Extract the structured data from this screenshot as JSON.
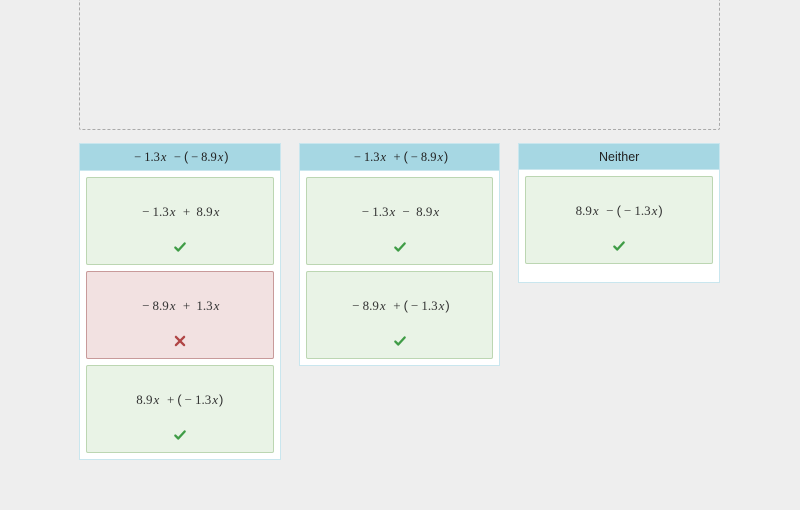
{
  "columns": [
    {
      "header_html": "<span class='mop'>−</span><span class='mnum'>1.3</span><span class='mi'>x</span> <span class='mop'>−</span>(<span class='mop'>−</span><span class='mnum'>8.9</span><span class='mi'>x</span>)",
      "cards": [
        {
          "expr_html": "<span class='mop'>−</span><span class='mnum'>1.3</span><span class='mi'>x</span><span class='mop'> + </span><span class='mnum'>8.9</span><span class='mi'>x</span>",
          "status": "correct"
        },
        {
          "expr_html": "<span class='mop'>−</span><span class='mnum'>8.9</span><span class='mi'>x</span><span class='mop'> + </span><span class='mnum'>1.3</span><span class='mi'>x</span>",
          "status": "incorrect"
        },
        {
          "expr_html": "<span class='mnum'>8.9</span><span class='mi'>x</span> <span class='mop'>+</span>(<span class='mop'>−</span><span class='mnum'>1.3</span><span class='mi'>x</span>)",
          "status": "correct"
        }
      ]
    },
    {
      "header_html": "<span class='mop'>−</span><span class='mnum'>1.3</span><span class='mi'>x</span> <span class='mop'>+</span>(<span class='mop'>−</span><span class='mnum'>8.9</span><span class='mi'>x</span>)",
      "cards": [
        {
          "expr_html": "<span class='mop'>−</span><span class='mnum'>1.3</span><span class='mi'>x</span><span class='mop'> − </span><span class='mnum'>8.9</span><span class='mi'>x</span>",
          "status": "correct"
        },
        {
          "expr_html": "<span class='mop'>−</span><span class='mnum'>8.9</span><span class='mi'>x</span> <span class='mop'>+</span>(<span class='mop'>−</span><span class='mnum'>1.3</span><span class='mi'>x</span>)",
          "status": "correct"
        }
      ]
    },
    {
      "header_html": "Neither",
      "cards": [
        {
          "expr_html": "<span class='mnum'>8.9</span><span class='mi'>x</span> <span class='mop'>−</span>(<span class='mop'>−</span><span class='mnum'>1.3</span><span class='mi'>x</span>)",
          "status": "correct"
        }
      ]
    }
  ],
  "icons": {
    "check": "✓",
    "cross": "✕"
  }
}
